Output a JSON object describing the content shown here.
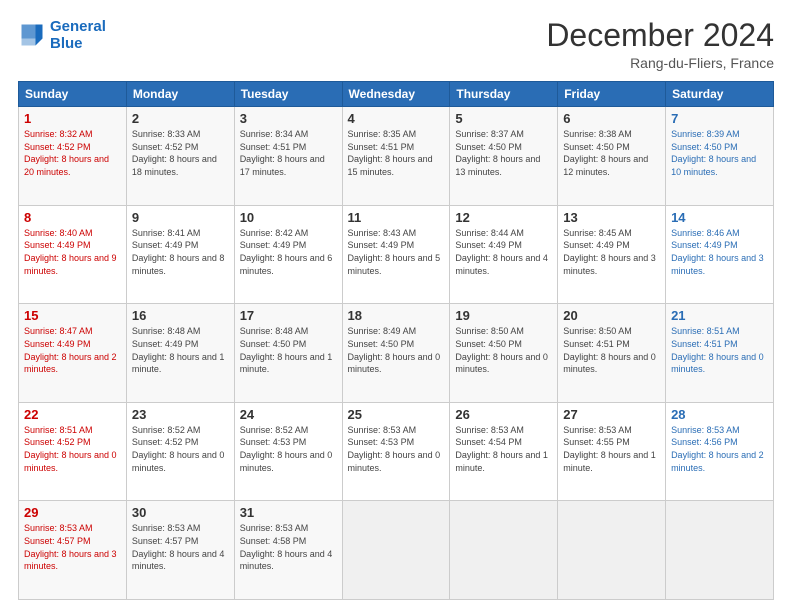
{
  "header": {
    "logo_line1": "General",
    "logo_line2": "Blue",
    "month": "December 2024",
    "location": "Rang-du-Fliers, France"
  },
  "columns": [
    "Sunday",
    "Monday",
    "Tuesday",
    "Wednesday",
    "Thursday",
    "Friday",
    "Saturday"
  ],
  "weeks": [
    [
      {
        "day": "1",
        "rise": "Sunrise: 8:32 AM",
        "set": "Sunset: 4:52 PM",
        "daylight": "Daylight: 8 hours and 20 minutes."
      },
      {
        "day": "2",
        "rise": "Sunrise: 8:33 AM",
        "set": "Sunset: 4:52 PM",
        "daylight": "Daylight: 8 hours and 18 minutes."
      },
      {
        "day": "3",
        "rise": "Sunrise: 8:34 AM",
        "set": "Sunset: 4:51 PM",
        "daylight": "Daylight: 8 hours and 17 minutes."
      },
      {
        "day": "4",
        "rise": "Sunrise: 8:35 AM",
        "set": "Sunset: 4:51 PM",
        "daylight": "Daylight: 8 hours and 15 minutes."
      },
      {
        "day": "5",
        "rise": "Sunrise: 8:37 AM",
        "set": "Sunset: 4:50 PM",
        "daylight": "Daylight: 8 hours and 13 minutes."
      },
      {
        "day": "6",
        "rise": "Sunrise: 8:38 AM",
        "set": "Sunset: 4:50 PM",
        "daylight": "Daylight: 8 hours and 12 minutes."
      },
      {
        "day": "7",
        "rise": "Sunrise: 8:39 AM",
        "set": "Sunset: 4:50 PM",
        "daylight": "Daylight: 8 hours and 10 minutes."
      }
    ],
    [
      {
        "day": "8",
        "rise": "Sunrise: 8:40 AM",
        "set": "Sunset: 4:49 PM",
        "daylight": "Daylight: 8 hours and 9 minutes."
      },
      {
        "day": "9",
        "rise": "Sunrise: 8:41 AM",
        "set": "Sunset: 4:49 PM",
        "daylight": "Daylight: 8 hours and 8 minutes."
      },
      {
        "day": "10",
        "rise": "Sunrise: 8:42 AM",
        "set": "Sunset: 4:49 PM",
        "daylight": "Daylight: 8 hours and 6 minutes."
      },
      {
        "day": "11",
        "rise": "Sunrise: 8:43 AM",
        "set": "Sunset: 4:49 PM",
        "daylight": "Daylight: 8 hours and 5 minutes."
      },
      {
        "day": "12",
        "rise": "Sunrise: 8:44 AM",
        "set": "Sunset: 4:49 PM",
        "daylight": "Daylight: 8 hours and 4 minutes."
      },
      {
        "day": "13",
        "rise": "Sunrise: 8:45 AM",
        "set": "Sunset: 4:49 PM",
        "daylight": "Daylight: 8 hours and 3 minutes."
      },
      {
        "day": "14",
        "rise": "Sunrise: 8:46 AM",
        "set": "Sunset: 4:49 PM",
        "daylight": "Daylight: 8 hours and 3 minutes."
      }
    ],
    [
      {
        "day": "15",
        "rise": "Sunrise: 8:47 AM",
        "set": "Sunset: 4:49 PM",
        "daylight": "Daylight: 8 hours and 2 minutes."
      },
      {
        "day": "16",
        "rise": "Sunrise: 8:48 AM",
        "set": "Sunset: 4:49 PM",
        "daylight": "Daylight: 8 hours and 1 minute."
      },
      {
        "day": "17",
        "rise": "Sunrise: 8:48 AM",
        "set": "Sunset: 4:50 PM",
        "daylight": "Daylight: 8 hours and 1 minute."
      },
      {
        "day": "18",
        "rise": "Sunrise: 8:49 AM",
        "set": "Sunset: 4:50 PM",
        "daylight": "Daylight: 8 hours and 0 minutes."
      },
      {
        "day": "19",
        "rise": "Sunrise: 8:50 AM",
        "set": "Sunset: 4:50 PM",
        "daylight": "Daylight: 8 hours and 0 minutes."
      },
      {
        "day": "20",
        "rise": "Sunrise: 8:50 AM",
        "set": "Sunset: 4:51 PM",
        "daylight": "Daylight: 8 hours and 0 minutes."
      },
      {
        "day": "21",
        "rise": "Sunrise: 8:51 AM",
        "set": "Sunset: 4:51 PM",
        "daylight": "Daylight: 8 hours and 0 minutes."
      }
    ],
    [
      {
        "day": "22",
        "rise": "Sunrise: 8:51 AM",
        "set": "Sunset: 4:52 PM",
        "daylight": "Daylight: 8 hours and 0 minutes."
      },
      {
        "day": "23",
        "rise": "Sunrise: 8:52 AM",
        "set": "Sunset: 4:52 PM",
        "daylight": "Daylight: 8 hours and 0 minutes."
      },
      {
        "day": "24",
        "rise": "Sunrise: 8:52 AM",
        "set": "Sunset: 4:53 PM",
        "daylight": "Daylight: 8 hours and 0 minutes."
      },
      {
        "day": "25",
        "rise": "Sunrise: 8:53 AM",
        "set": "Sunset: 4:53 PM",
        "daylight": "Daylight: 8 hours and 0 minutes."
      },
      {
        "day": "26",
        "rise": "Sunrise: 8:53 AM",
        "set": "Sunset: 4:54 PM",
        "daylight": "Daylight: 8 hours and 1 minute."
      },
      {
        "day": "27",
        "rise": "Sunrise: 8:53 AM",
        "set": "Sunset: 4:55 PM",
        "daylight": "Daylight: 8 hours and 1 minute."
      },
      {
        "day": "28",
        "rise": "Sunrise: 8:53 AM",
        "set": "Sunset: 4:56 PM",
        "daylight": "Daylight: 8 hours and 2 minutes."
      }
    ],
    [
      {
        "day": "29",
        "rise": "Sunrise: 8:53 AM",
        "set": "Sunset: 4:57 PM",
        "daylight": "Daylight: 8 hours and 3 minutes."
      },
      {
        "day": "30",
        "rise": "Sunrise: 8:53 AM",
        "set": "Sunset: 4:57 PM",
        "daylight": "Daylight: 8 hours and 4 minutes."
      },
      {
        "day": "31",
        "rise": "Sunrise: 8:53 AM",
        "set": "Sunset: 4:58 PM",
        "daylight": "Daylight: 8 hours and 4 minutes."
      },
      {
        "day": "",
        "rise": "",
        "set": "",
        "daylight": ""
      },
      {
        "day": "",
        "rise": "",
        "set": "",
        "daylight": ""
      },
      {
        "day": "",
        "rise": "",
        "set": "",
        "daylight": ""
      },
      {
        "day": "",
        "rise": "",
        "set": "",
        "daylight": ""
      }
    ]
  ]
}
